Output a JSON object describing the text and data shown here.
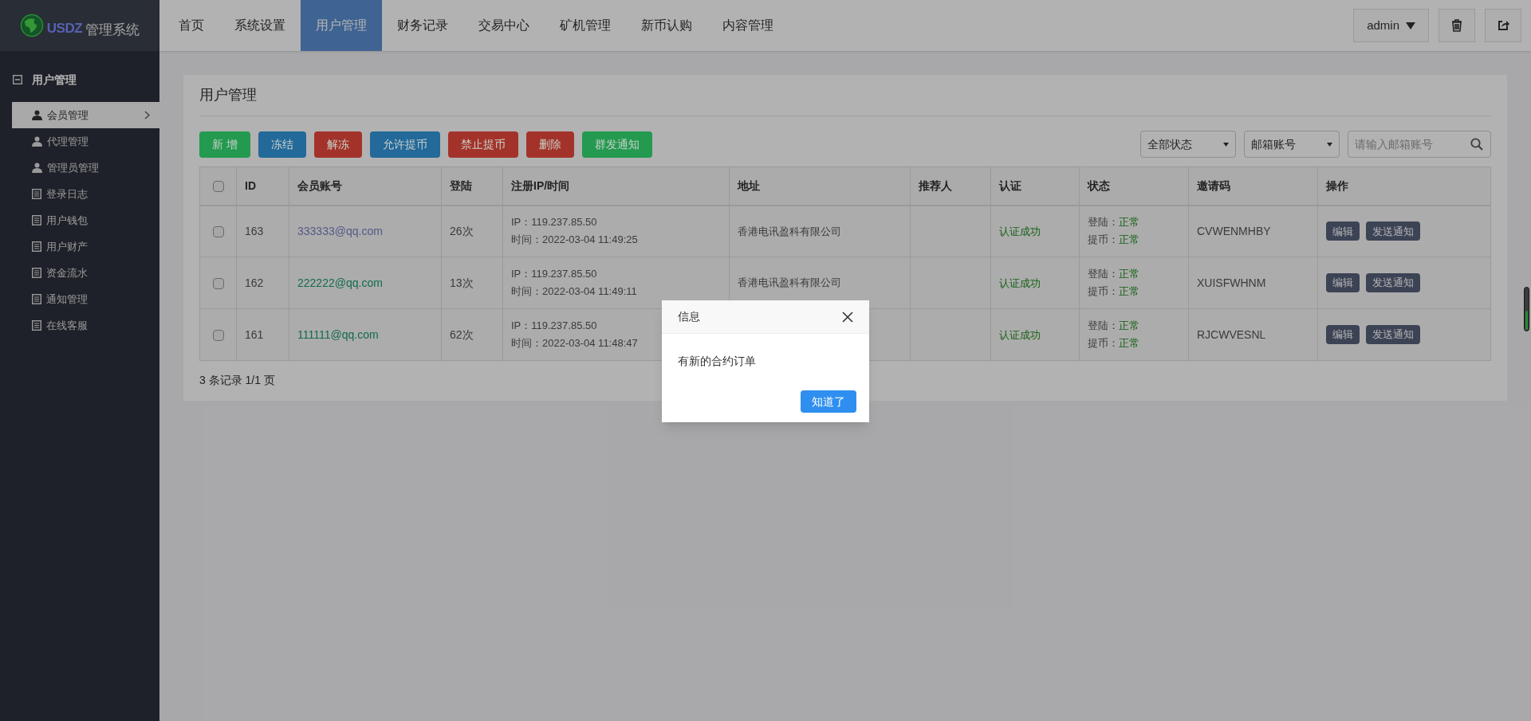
{
  "header": {
    "logo_text": "USDZ",
    "title": "管理系统",
    "nav": [
      {
        "label": "首页",
        "selected": false
      },
      {
        "label": "系统设置",
        "selected": false
      },
      {
        "label": "用户管理",
        "selected": true
      },
      {
        "label": "财务记录",
        "selected": false
      },
      {
        "label": "交易中心",
        "selected": false
      },
      {
        "label": "矿机管理",
        "selected": false
      },
      {
        "label": "新币认购",
        "selected": false
      },
      {
        "label": "内容管理",
        "selected": false
      }
    ],
    "user_menu": "admin"
  },
  "sidebar": {
    "group": {
      "label": "用户管理",
      "expanded": true,
      "items": [
        {
          "label": "会员管理",
          "kind": "user",
          "selected": true
        },
        {
          "label": "代理管理",
          "kind": "user",
          "selected": false
        },
        {
          "label": "管理员管理",
          "kind": "user",
          "selected": false
        },
        {
          "label": "登录日志",
          "kind": "list",
          "selected": false
        },
        {
          "label": "用户钱包",
          "kind": "list",
          "selected": false
        },
        {
          "label": "用户财产",
          "kind": "list",
          "selected": false
        },
        {
          "label": "资金流水",
          "kind": "list",
          "selected": false
        },
        {
          "label": "通知管理",
          "kind": "list",
          "selected": false
        },
        {
          "label": "在线客服",
          "kind": "list",
          "selected": false
        }
      ]
    }
  },
  "panel": {
    "title": "用户管理",
    "toolbar": [
      {
        "label": "新 增",
        "color": "#239a4f"
      },
      {
        "label": "冻结",
        "color": "#23699a"
      },
      {
        "label": "解冻",
        "color": "#a3332a"
      },
      {
        "label": "允许提币",
        "color": "#23699a"
      },
      {
        "label": "禁止提币",
        "color": "#a3332a"
      },
      {
        "label": "删除",
        "color": "#a3332a"
      },
      {
        "label": "群发通知",
        "color": "#239a4f"
      }
    ],
    "status_filter": "全部状态",
    "field_filter": "邮箱账号",
    "search": {
      "placeholder": "请输入邮箱账号"
    },
    "table": {
      "select_all": false,
      "columns": [
        "ID",
        "会员账号",
        "登陆",
        "注册IP/时间",
        "地址",
        "推荐人",
        "认证",
        "状态",
        "邀请码",
        "操作"
      ],
      "rows": [
        {
          "selected": false,
          "id": "163",
          "account": "333333@qq.com",
          "visited": true,
          "logins": "26次",
          "ip": "IP：119.237.85.50",
          "time": "时间：2022-03-04 11:49:25",
          "address": "香港电讯盈科有限公司",
          "auth": "认证成功",
          "status": [
            {
              "label": "登陆：",
              "value": "正常"
            },
            {
              "label": "提币：",
              "value": "正常"
            }
          ],
          "invite_code": "CVWENMHBY",
          "actions": [
            "编辑",
            "发送通知"
          ]
        },
        {
          "selected": false,
          "id": "162",
          "account": "222222@qq.com",
          "visited": false,
          "logins": "13次",
          "ip": "IP：119.237.85.50",
          "time": "时间：2022-03-04 11:49:11",
          "address": "香港电讯盈科有限公司",
          "auth": "认证成功",
          "status": [
            {
              "label": "登陆：",
              "value": "正常"
            },
            {
              "label": "提币：",
              "value": "正常"
            }
          ],
          "invite_code": "XUISFWHNM",
          "actions": [
            "编辑",
            "发送通知"
          ]
        },
        {
          "selected": false,
          "id": "161",
          "account": "111111@qq.com",
          "visited": false,
          "logins": "62次",
          "ip": "IP：119.237.85.50",
          "time": "时间：2022-03-04 11:48:47",
          "auth": "认证成功",
          "status": [
            {
              "label": "登陆：",
              "value": "正常"
            },
            {
              "label": "提币：",
              "value": "正常"
            }
          ],
          "invite_code": "RJCWVESNL",
          "actions": [
            "编辑",
            "发送通知"
          ]
        }
      ]
    },
    "footer": "3 条记录 1/1 页"
  },
  "dialog": {
    "title": "信息",
    "message": "有新的合约订单",
    "button": "知道了"
  }
}
